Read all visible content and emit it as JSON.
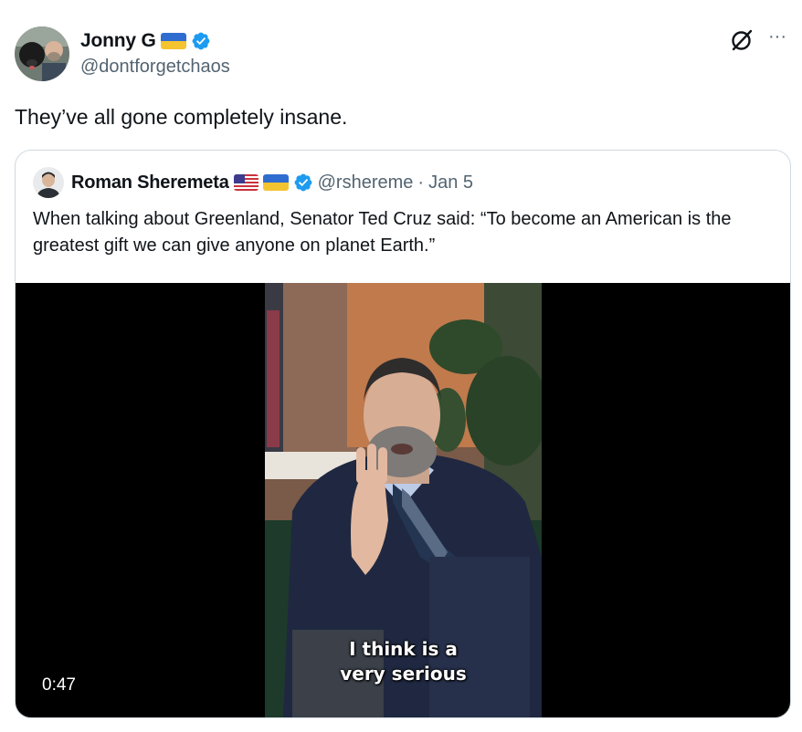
{
  "tweet": {
    "author": {
      "display_name": "Jonny G",
      "handle": "@dontforgetchaos",
      "avatar_icon": "avatar-photo-man-with-dog",
      "flag_icon": "ukraine-flag-icon",
      "verified_icon": "verified-badge-icon",
      "verified_color": "#1d9bf0"
    },
    "grok_icon": "grok-icon",
    "more_icon": "more-options-icon",
    "more_label": "···",
    "text": "They’ve all gone completely insane."
  },
  "quote": {
    "author": {
      "display_name": "Roman Sheremeta",
      "handle": "@rshereme",
      "separator": "·",
      "date": "Jan 5",
      "flags": [
        "us-flag-icon",
        "ukraine-flag-icon"
      ],
      "verified_icon": "verified-badge-icon"
    },
    "text": "When talking about Greenland, Senator Ted Cruz said: “To become an American is the greatest gift we can give anyone on planet Earth.”",
    "video": {
      "duration": "0:47",
      "caption_line1": "I think is a",
      "caption_line2": "very serious"
    }
  },
  "colors": {
    "text_primary": "#0f1419",
    "text_secondary": "#536471",
    "border": "#cfd9de",
    "verified_blue": "#1d9bf0",
    "ukraine_blue": "#2f6ccf",
    "ukraine_yellow": "#f4c430"
  }
}
